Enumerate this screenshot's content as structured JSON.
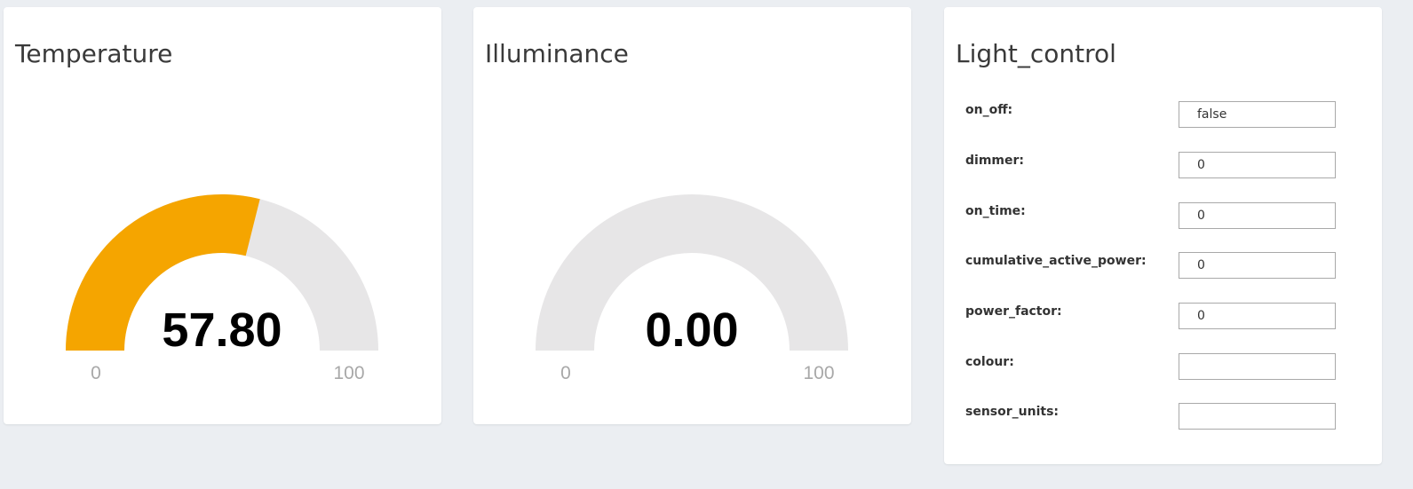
{
  "temperature": {
    "title": "Temperature",
    "value": "57.80",
    "min": "0",
    "max": "100",
    "level": 57.8,
    "fill_color": "#f5a500",
    "track_color": "#e7e6e7"
  },
  "illuminance": {
    "title": "Illuminance",
    "value": "0.00",
    "min": "0",
    "max": "100",
    "level": 0,
    "fill_color": "#f5a500",
    "track_color": "#e7e6e7"
  },
  "light_control": {
    "title": "Light_control",
    "fields": [
      {
        "label": "on_off:",
        "value": "false"
      },
      {
        "label": "dimmer:",
        "value": "0"
      },
      {
        "label": "on_time:",
        "value": "0"
      },
      {
        "label": "cumulative_active_power:",
        "value": "0"
      },
      {
        "label": "power_factor:",
        "value": "0"
      },
      {
        "label": "colour:",
        "value": ""
      },
      {
        "label": "sensor_units:",
        "value": ""
      }
    ]
  }
}
